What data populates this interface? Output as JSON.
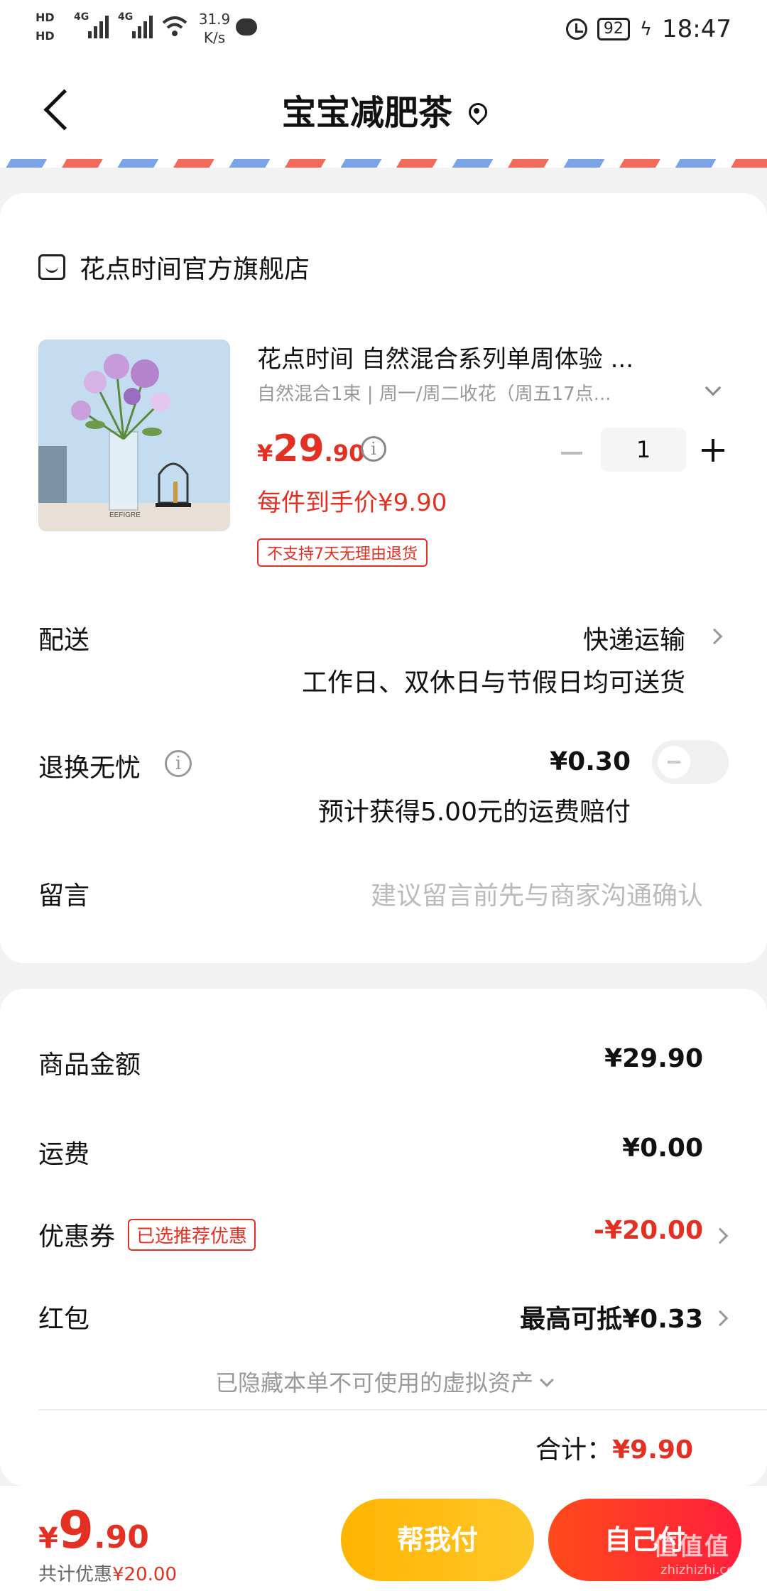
{
  "status_bar": {
    "hd1": "HD",
    "hd2": "HD",
    "net1": "4G",
    "net2": "4G",
    "speed_value": "31.9",
    "speed_unit": "K/s",
    "battery": "92",
    "time": "18:47"
  },
  "header": {
    "title": "宝宝减肥茶"
  },
  "shop": {
    "name": "花点时间官方旗舰店"
  },
  "product": {
    "title": "花点时间 自然混合系列单周体验 ...",
    "spec": "自然混合1束 | 周一/周二收花（周五17点...",
    "price_currency": "¥",
    "price_int": "29",
    "price_dec": ".90",
    "quantity": "1",
    "unit_price": "每件到手价¥9.90",
    "return_tag": "不支持7天无理由退货",
    "image_text": "EEFIGRE"
  },
  "delivery": {
    "label": "配送",
    "method": "快递运输",
    "note": "工作日、双休日与节假日均可送货"
  },
  "return_service": {
    "label": "退换无忧",
    "price": "¥0.30",
    "note": "预计获得5.00元的运费赔付",
    "enabled": false
  },
  "message": {
    "label": "留言",
    "placeholder": "建议留言前先与商家沟通确认"
  },
  "summary": {
    "goods_label": "商品金额",
    "goods_value": "¥29.90",
    "shipping_label": "运费",
    "shipping_value": "¥0.00",
    "coupon_label": "优惠券",
    "coupon_tag": "已选推荐优惠",
    "coupon_value": "-¥20.00",
    "redpacket_label": "红包",
    "redpacket_value": "最高可抵¥0.33",
    "hidden_assets": "已隐藏本单不可使用的虚拟资产",
    "total_label": "合计：",
    "total_value": "¥9.90"
  },
  "bottom": {
    "pay_currency": "¥",
    "pay_int": "9",
    "pay_dec": ".90",
    "discount_label": "共计优惠",
    "discount_value": "¥20.00",
    "help_pay": "帮我付",
    "self_pay": "自己付",
    "watermark": "值值值",
    "watermark_sub": "zhizhizhi.com"
  },
  "colors": {
    "accent_red": "#e33022",
    "help_button": "#ffb400",
    "self_button": "#ff2a2a"
  }
}
